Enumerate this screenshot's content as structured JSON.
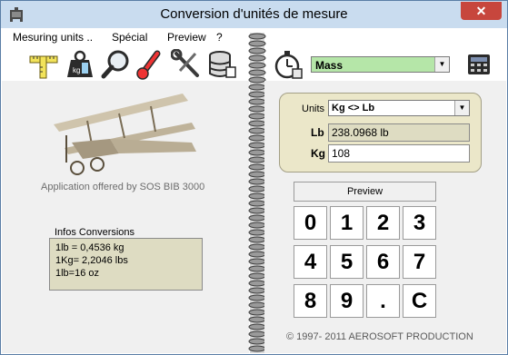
{
  "window": {
    "title": "Conversion d'unités de mesure",
    "close_glyph": "✕"
  },
  "menu": [
    "Mesuring units ..",
    "Spécial",
    "Preview",
    "?"
  ],
  "toolbar": {
    "icons": [
      "ruler-icon",
      "weight-icon",
      "magnifier-icon",
      "thermometer-icon",
      "tools-icon",
      "database-icon",
      "stopwatch-icon",
      "calculator-icon"
    ],
    "category": "Mass"
  },
  "left": {
    "credit": "Application offered by SOS BIB 3000",
    "info_title": "Infos  Conversions",
    "info_lines": [
      "1lb = 0,4536 kg",
      "1Kg= 2,2046 lbs",
      "1lb=16 oz"
    ]
  },
  "conversion": {
    "units_label": "Units",
    "units_value": "Kg <> Lb",
    "lb_label": "Lb",
    "lb_value": "238.0968 lb",
    "kg_label": "Kg",
    "kg_value": "108"
  },
  "preview_label": "Preview",
  "keypad": [
    "0",
    "1",
    "2",
    "3",
    "4",
    "5",
    "6",
    "7",
    "8",
    "9",
    ".",
    "C"
  ],
  "copyright": "©  1997- 2011 AEROSOFT PRODUCTION",
  "colors": {
    "titlebar": "#c9dcef",
    "mass_select": "#b5e6a8",
    "units_panel": "#ebe7c9",
    "info_box": "#dedcc2",
    "close_button": "#c7463d"
  }
}
